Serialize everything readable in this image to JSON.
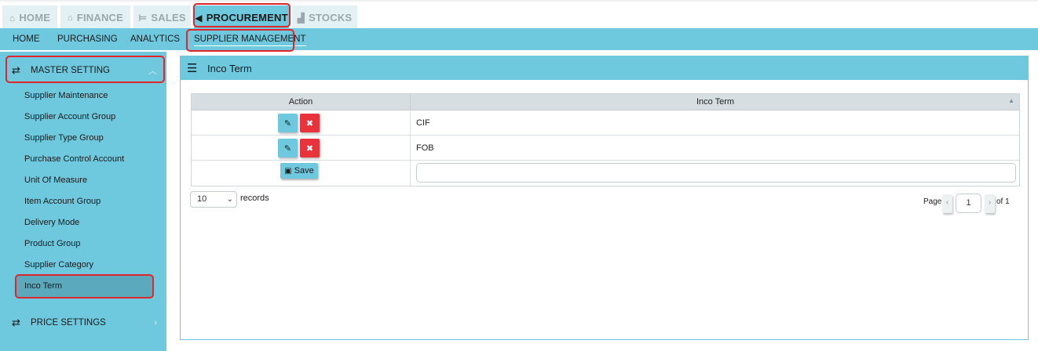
{
  "top_tabs": [
    {
      "label": "HOME",
      "icon": "home-icon",
      "glyph": "⌂"
    },
    {
      "label": "FINANCE",
      "icon": "bank-icon",
      "glyph": "🏛"
    },
    {
      "label": "SALES",
      "icon": "cart-icon",
      "glyph": "🛒"
    },
    {
      "label": "PROCUREMENT",
      "icon": "megaphone-icon",
      "glyph": "📢"
    },
    {
      "label": "STOCKS",
      "icon": "chart-icon",
      "glyph": "▟"
    }
  ],
  "sub_nav": [
    "HOME",
    "PURCHASING",
    "ANALYTICS",
    "SUPPLIER MANAGEMENT"
  ],
  "sidebar": {
    "master_setting": "MASTER SETTING",
    "items": [
      "Supplier Maintenance",
      "Supplier Account Group",
      "Supplier Type Group",
      "Purchase Control Account",
      "Unit Of Measure",
      "Item Account Group",
      "Delivery Mode",
      "Product Group",
      "Supplier Category",
      "Inco Term"
    ],
    "price_settings": "PRICE SETTINGS"
  },
  "panel": {
    "title": "Inco Term",
    "columns": {
      "action": "Action",
      "inco_term": "Inco Term"
    },
    "rows": [
      "CIF",
      "FOB"
    ],
    "save_label": "Save",
    "new_term_value": ""
  },
  "footer": {
    "page_size": "10",
    "records_label": "records",
    "page_label": "Page",
    "current_page": "1",
    "of_label": "of 1"
  },
  "colors": {
    "accent": "#6ec8de",
    "delete": "#e8323c",
    "highlight": "#e0262a"
  }
}
